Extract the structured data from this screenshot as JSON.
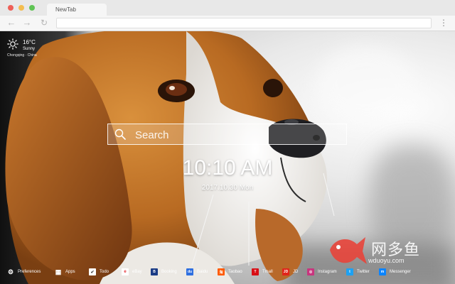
{
  "browser": {
    "tab_title": "NewTab",
    "back_glyph": "←",
    "forward_glyph": "→",
    "reload_glyph": "↻",
    "menu_glyph": "⋮"
  },
  "weather": {
    "icon": "sun-icon",
    "temperature": "16°C",
    "condition": "Sunny",
    "location": "Chongqing · China"
  },
  "search": {
    "placeholder": "Search",
    "value": ""
  },
  "clock": {
    "time": "10:10 AM",
    "date": "2017.10.30 Mon"
  },
  "watermark": {
    "text": "网多鱼",
    "url": "wduoyu.com",
    "accent": "#e8443a"
  },
  "shortcuts": [
    {
      "label": "Preferences",
      "icon": "gear-icon",
      "color": "#ffffff",
      "glyph": "⚙"
    },
    {
      "label": "Apps",
      "icon": "apps-grid-icon",
      "color": "#ffffff",
      "glyph": "▦"
    },
    {
      "label": "Todo",
      "icon": "checkbox-icon",
      "color": "#ffffff",
      "glyph": "✔"
    },
    {
      "label": "eBay",
      "icon": "ebay-icon",
      "color": "#ffffff",
      "glyph": "e"
    },
    {
      "label": "Booking",
      "icon": "booking-icon",
      "color": "#1b3c86",
      "glyph": "B"
    },
    {
      "label": "Baidu",
      "icon": "baidu-icon",
      "color": "#2e6fe0",
      "glyph": "du"
    },
    {
      "label": "Taobao",
      "icon": "taobao-icon",
      "color": "#ff5a00",
      "glyph": "淘"
    },
    {
      "label": "Tmall",
      "icon": "tmall-icon",
      "color": "#d80f16",
      "glyph": "T"
    },
    {
      "label": "JD",
      "icon": "jd-icon",
      "color": "#e1251b",
      "glyph": "JD"
    },
    {
      "label": "Instagram",
      "icon": "instagram-icon",
      "color": "#c8357e",
      "glyph": "◎"
    },
    {
      "label": "Twitter",
      "icon": "twitter-icon",
      "color": "#1da1f2",
      "glyph": "t"
    },
    {
      "label": "Messenger",
      "icon": "messenger-icon",
      "color": "#0a84ff",
      "glyph": "m"
    }
  ]
}
